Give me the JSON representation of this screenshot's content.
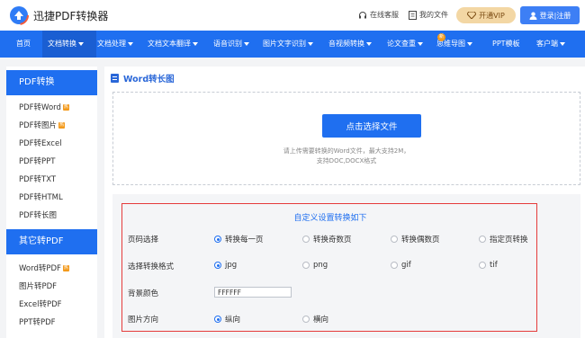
{
  "header": {
    "brand": "迅捷PDF转换器",
    "service_label": "在线客服",
    "my_files_label": "我的文件",
    "vip_label": "开通VIP",
    "login_label": "登录|注册"
  },
  "nav": {
    "items": [
      {
        "label": "首页",
        "dropdown": false
      },
      {
        "label": "文档转换",
        "dropdown": true,
        "active": true
      },
      {
        "label": "文档处理",
        "dropdown": true
      },
      {
        "label": "文档文本翻译",
        "dropdown": true
      },
      {
        "label": "语音识别",
        "dropdown": true
      },
      {
        "label": "图片文字识别",
        "dropdown": true
      },
      {
        "label": "音视频转换",
        "dropdown": true
      },
      {
        "label": "论文查重",
        "dropdown": true
      },
      {
        "label": "思维导图",
        "dropdown": true
      },
      {
        "label": "PPT模板",
        "dropdown": false
      },
      {
        "label": "客户端",
        "dropdown": true
      }
    ],
    "new_badge": "新"
  },
  "sidebar": {
    "section1_title": "PDF转换",
    "section1_items": [
      {
        "label": "PDF转Word",
        "hot": true
      },
      {
        "label": "PDF转图片",
        "hot": true
      },
      {
        "label": "PDF转Excel",
        "hot": false
      },
      {
        "label": "PDF转PPT",
        "hot": false
      },
      {
        "label": "PDF转TXT",
        "hot": false
      },
      {
        "label": "PDF转HTML",
        "hot": false
      },
      {
        "label": "PDF转长图",
        "hot": false
      }
    ],
    "section2_title": "其它转PDF",
    "section2_items": [
      {
        "label": "Word转PDF",
        "hot": true
      },
      {
        "label": "图片转PDF",
        "hot": false
      },
      {
        "label": "Excel转PDF",
        "hot": false
      },
      {
        "label": "PPT转PDF",
        "hot": false
      }
    ],
    "hot_badge": "热"
  },
  "main": {
    "title": "Word转长图",
    "upload_button": "点击选择文件",
    "upload_hint_line1": "请上传需要转换的Word文件，最大支持2M，",
    "upload_hint_line2": "支持DOC,DOCX格式",
    "settings_title": "自定义设置转换如下",
    "page_select": {
      "label": "页码选择",
      "options": [
        "转换每一页",
        "转换奇数页",
        "转换偶数页",
        "指定页转换"
      ],
      "selected": 0
    },
    "format": {
      "label": "选择转换格式",
      "options": [
        "jpg",
        "png",
        "gif",
        "tif"
      ],
      "selected": 0
    },
    "bg_color": {
      "label": "背景颜色",
      "value": "FFFFFF"
    },
    "orientation": {
      "label": "图片方向",
      "options": [
        "纵向",
        "横向"
      ],
      "selected": 0
    }
  },
  "colors": {
    "primary": "#1f6ff0",
    "highlight_border": "#e53b3b",
    "vip_bg": "#f3d7a4",
    "hot_badge": "#f39a1c"
  }
}
